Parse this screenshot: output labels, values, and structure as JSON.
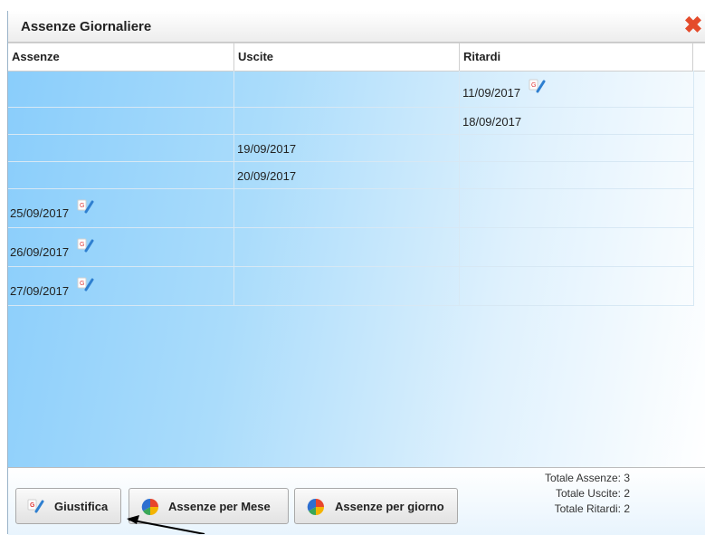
{
  "dialog": {
    "title": "Assenze Giornaliere",
    "close_icon": "close-x-icon"
  },
  "table": {
    "columns": [
      "Assenze",
      "Uscite",
      "Ritardi"
    ],
    "rows": [
      {
        "assenze": "",
        "uscite": "",
        "ritardi": "11/09/2017",
        "edit": "ritardi"
      },
      {
        "assenze": "",
        "uscite": "",
        "ritardi": "18/09/2017",
        "edit": ""
      },
      {
        "assenze": "",
        "uscite": "19/09/2017",
        "ritardi": "",
        "edit": ""
      },
      {
        "assenze": "",
        "uscite": "20/09/2017",
        "ritardi": "",
        "edit": ""
      },
      {
        "assenze": "25/09/2017",
        "uscite": "",
        "ritardi": "",
        "edit": "assenze"
      },
      {
        "assenze": "26/09/2017",
        "uscite": "",
        "ritardi": "",
        "edit": "assenze"
      },
      {
        "assenze": "27/09/2017",
        "uscite": "",
        "ritardi": "",
        "edit": "assenze"
      }
    ]
  },
  "buttons": {
    "giustifica": "Giustifica",
    "per_mese": "Assenze per Mese",
    "per_giorno": "Assenze per giorno"
  },
  "totals": {
    "assenze": "Totale Assenze: 3",
    "uscite": "Totale Uscite: 2",
    "ritardi": "Totale Ritardi: 2"
  },
  "colors": {
    "close": "#e44b2b",
    "grid_bg_start": "#89cdfb",
    "grid_bg_end": "#ffffff"
  }
}
